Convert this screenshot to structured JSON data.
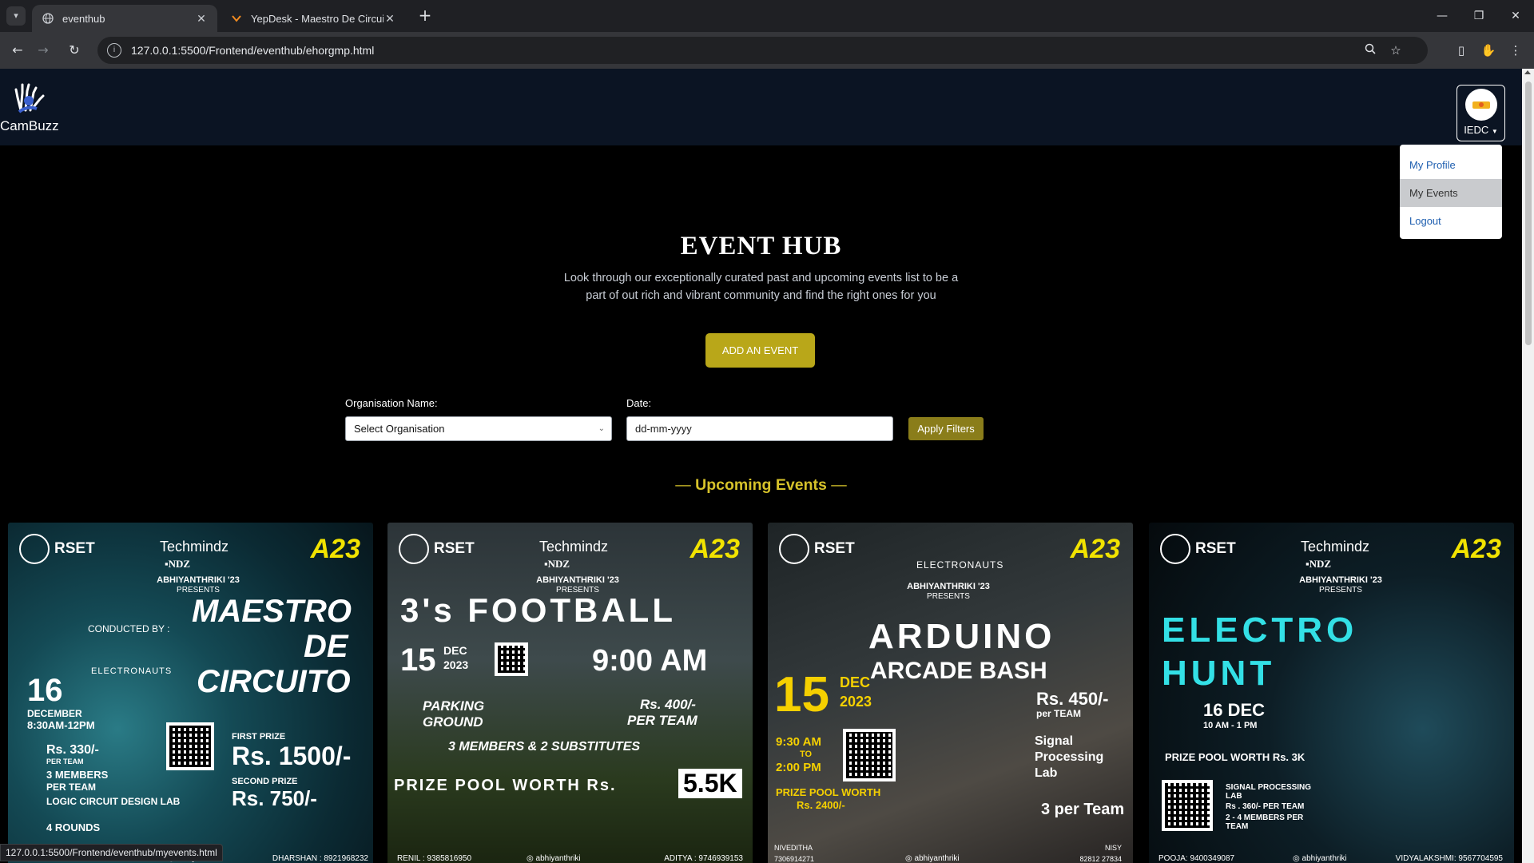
{
  "browser": {
    "tabs": [
      {
        "title": "eventhub",
        "active": true
      },
      {
        "title": "YepDesk - Maestro De Circuito",
        "active": false
      }
    ],
    "url": "127.0.0.1:5500/Frontend/eventhub/ehorgmp.html",
    "status_url": "127.0.0.1:5500/Frontend/eventhub/myevents.html"
  },
  "navbar": {
    "logo_text": "CamBuzz",
    "profile_label": "IEDC",
    "dropdown": [
      "My Profile",
      "My Events",
      "Logout"
    ]
  },
  "hero": {
    "title": "EVENT HUB",
    "subtitle": "Look through our exceptionally curated past and upcoming events list to be a part of out rich and vibrant community and find the right ones for you",
    "add_button": "ADD AN EVENT"
  },
  "filters": {
    "org_label": "Organisation Name:",
    "org_value": "Select Organisation",
    "date_label": "Date:",
    "date_placeholder": "dd-mm-yyyy",
    "apply_button": "Apply Filters"
  },
  "section_title": "Upcoming Events",
  "events": [
    {
      "org": "RSET",
      "sponsor": "Techmindz",
      "presents": "ABHIYANTHRIKI '23",
      "presents_sub": "PRESENTS",
      "title_1": "MAESTRO",
      "title_2": "DE",
      "title_3": "CIRCUITO",
      "conducted": "CONDUCTED BY :",
      "club": "ELECTRONAUTS",
      "date": "16",
      "month": "DECEMBER",
      "time": "8:30AM-12PM",
      "fee": "Rs. 330/-",
      "fee_unit": "PER TEAM",
      "team": "3 MEMBERS",
      "team_unit": "PER TEAM",
      "venue": "LOGIC CIRCUIT DESIGN LAB",
      "rounds": "4 ROUNDS",
      "prize_1_label": "FIRST PRIZE",
      "prize_1": "Rs. 1500/-",
      "prize_2_label": "SECOND PRIZE",
      "prize_2": "Rs. 750/-",
      "contact": "DHARSHAN : 8921968232",
      "handle": "abhiyanthriki"
    },
    {
      "org": "RSET",
      "sponsor": "Techmindz",
      "presents": "ABHIYANTHRIKI '23",
      "presents_sub": "PRESENTS",
      "title": "3's FOOTBALL",
      "date": "15",
      "month": "DEC",
      "year": "2023",
      "time": "9:00 AM",
      "venue": "PARKING GROUND",
      "fee": "Rs. 400/-",
      "fee_unit": "PER TEAM",
      "team": "3 MEMBERS & 2 SUBSTITUTES",
      "prize": "PRIZE POOL WORTH Rs.",
      "prize_amt": "5.5K",
      "contact_1": "RENIL : 9385816950",
      "handle": "abhiyanthriki",
      "contact_2": "ADITYA : 9746939153"
    },
    {
      "org": "RSET",
      "club": "ELECTRONAUTS",
      "presents": "ABHIYANTHRIKI '23",
      "presents_sub": "PRESENTS",
      "title_1": "ARDUINO",
      "title_2": "ARCADE BASH",
      "date": "15",
      "month": "DEC",
      "year": "2023",
      "time_1": "9:30 AM",
      "time_to": "TO",
      "time_2": "2:00 PM",
      "fee": "Rs. 450/-",
      "fee_unit": "per TEAM",
      "venue": "Signal Processing Lab",
      "team": "3 per Team",
      "prize": "PRIZE POOL WORTH",
      "prize_amt": "Rs. 2400/-",
      "contact_1": "NIVEDITHA",
      "contact_1_no": "7306914271",
      "handle": "abhiyanthriki",
      "contact_2": "NISY",
      "contact_2_no": "82812 27834"
    },
    {
      "org": "RSET",
      "sponsor": "Techmindz",
      "presents": "ABHIYANTHRIKI '23",
      "presents_sub": "PRESENTS",
      "title_1": "ELECTRO",
      "title_2": "HUNT",
      "date": "16 DEC",
      "time": "10 AM - 1 PM",
      "prize": "PRIZE POOL WORTH Rs. 3K",
      "venue": "SIGNAL PROCESSING LAB",
      "fee": "Rs . 360/- PER TEAM",
      "team": "2 - 4 MEMBERS PER TEAM",
      "contact_1": "POOJA: 9400349087",
      "handle": "abhiyanthriki",
      "contact_2": "VIDYALAKSHMI: 9567704595"
    }
  ],
  "colors": {
    "accent": "#b9a719",
    "section": "#d6c22a",
    "navbar": "#0b1423",
    "electro": "#33e0e6"
  }
}
